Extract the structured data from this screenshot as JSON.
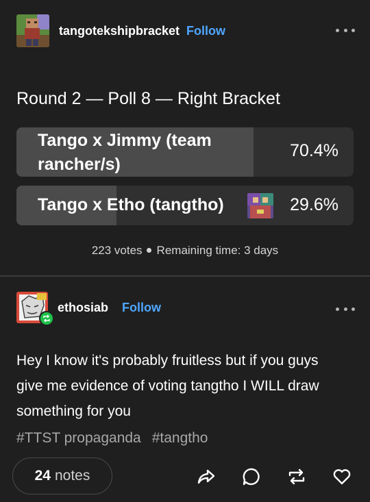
{
  "post": {
    "author": "tangotekshipbracket",
    "follow_label": "Follow"
  },
  "poll": {
    "title": "Round 2 — Poll 8 — Right Bracket",
    "options": [
      {
        "label": "Tango x Jimmy (team rancher/s)",
        "percent": "70.4%",
        "fraction": 0.704
      },
      {
        "label": "Tango x Etho (tangtho)",
        "percent": "29.6%",
        "fraction": 0.296
      }
    ],
    "votes": "223 votes",
    "remaining": "Remaining time: 3 days"
  },
  "reblog": {
    "author": "ethosiab",
    "follow_label": "Follow",
    "text": "Hey I know it's probably fruitless but if you guys give me evidence of voting tangtho I WILL draw something for you",
    "tags": [
      "#TTST propaganda",
      "#tangtho"
    ]
  },
  "footer": {
    "notes_count": "24",
    "notes_word": "notes",
    "icons": [
      "share-icon",
      "reply-icon",
      "reblog-icon",
      "like-icon"
    ]
  },
  "colors": {
    "background": "#1f1f1f",
    "follow_link": "#4fa6ff",
    "poll_fill": "#4b4b4b",
    "poll_track": "#303030",
    "reblog_badge": "#1fc24b"
  }
}
